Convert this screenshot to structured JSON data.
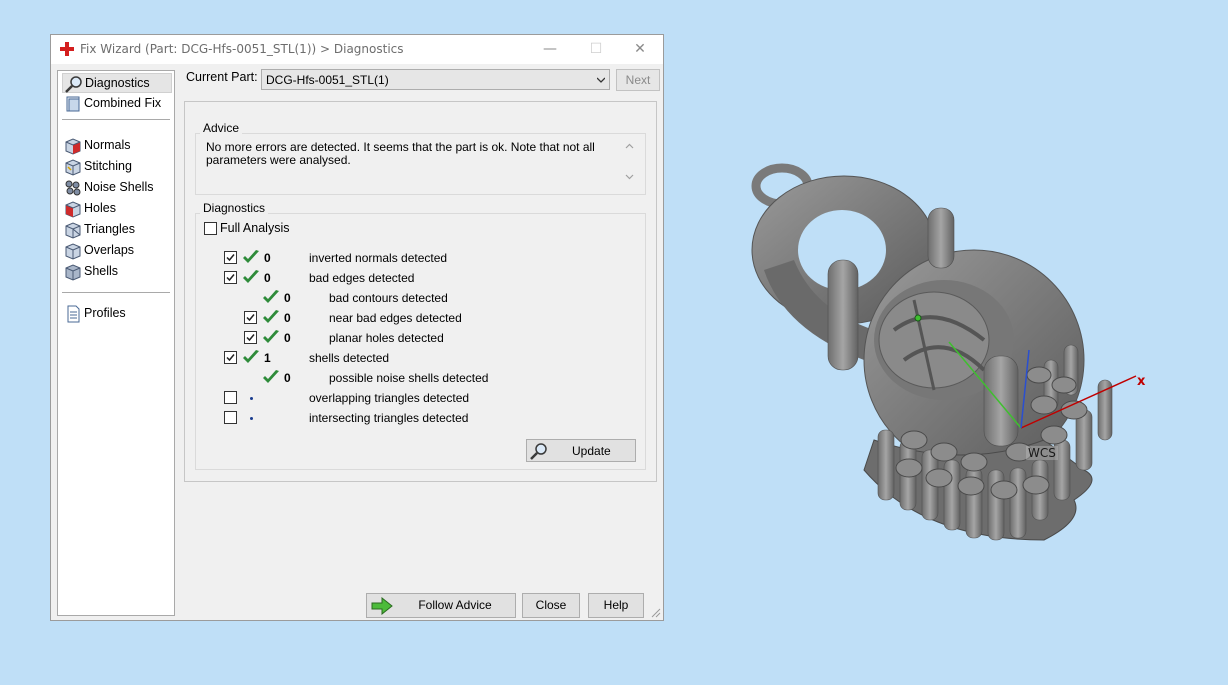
{
  "window": {
    "title": "Fix Wizard (Part: DCG-Hfs-0051_STL(1)) > Diagnostics",
    "minimize": "—",
    "maximize": "☐",
    "close": "✕"
  },
  "sidebar": {
    "items": [
      {
        "label": "Diagnostics",
        "icon": "magnifier-icon",
        "selected": true
      },
      {
        "label": "Combined Fix",
        "icon": "combined-fix-icon"
      },
      {
        "label": "Normals",
        "icon": "normals-cube-icon"
      },
      {
        "label": "Stitching",
        "icon": "stitching-cube-icon"
      },
      {
        "label": "Noise Shells",
        "icon": "noise-shells-icon"
      },
      {
        "label": "Holes",
        "icon": "holes-cube-icon"
      },
      {
        "label": "Triangles",
        "icon": "triangles-cube-icon"
      },
      {
        "label": "Overlaps",
        "icon": "overlaps-cube-icon"
      },
      {
        "label": "Shells",
        "icon": "shells-cube-icon"
      },
      {
        "label": "Profiles",
        "icon": "document-icon"
      }
    ]
  },
  "current_part": {
    "label": "Current Part:",
    "value": "DCG-Hfs-0051_STL(1)",
    "next_label": "Next"
  },
  "advice": {
    "title": "Advice",
    "text": "No more errors are detected. It seems that the part is ok. Note that not all parameters were analysed."
  },
  "diagnostics": {
    "title": "Diagnostics",
    "full_analysis_label": "Full Analysis",
    "full_analysis_checked": false,
    "rows": [
      {
        "checked": true,
        "status": "ok",
        "count": "0",
        "text": "inverted normals detected"
      },
      {
        "checked": true,
        "status": "ok",
        "count": "0",
        "text": "bad edges detected"
      },
      {
        "checked": null,
        "status": "ok",
        "count": "0",
        "text": "bad contours detected"
      },
      {
        "checked": true,
        "status": "ok",
        "count": "0",
        "text": "near bad edges detected"
      },
      {
        "checked": true,
        "status": "ok",
        "count": "0",
        "text": "planar holes detected"
      },
      {
        "checked": true,
        "status": "ok",
        "count": "1",
        "text": "shells detected"
      },
      {
        "checked": null,
        "status": "ok",
        "count": "0",
        "text": "possible noise shells detected"
      },
      {
        "checked": false,
        "status": "pending",
        "count": "",
        "text": "overlapping triangles detected"
      },
      {
        "checked": false,
        "status": "pending",
        "count": "",
        "text": "intersecting triangles detected"
      }
    ],
    "update_label": "Update"
  },
  "buttons": {
    "follow_advice": "Follow Advice",
    "close": "Close",
    "help": "Help"
  },
  "viewport": {
    "wcs_label": "WCS",
    "x_axis_label": "x",
    "colors": {
      "background": "#bfdff7",
      "model": "#7d7d7d",
      "x_axis": "#c00000",
      "y_axis": "#3fbf2f",
      "z_axis": "#2a4fd0"
    }
  }
}
